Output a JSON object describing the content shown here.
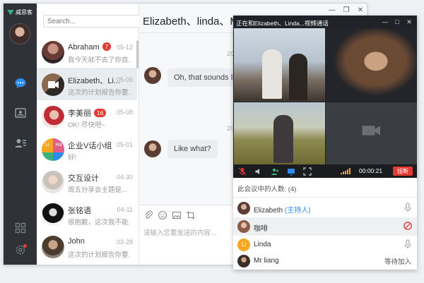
{
  "app": {
    "name": "威思客"
  },
  "sidebar": {
    "icons": [
      "chat-icon",
      "contacts-card-icon",
      "user-list-icon",
      "apps-grid-icon",
      "settings-icon"
    ]
  },
  "search": {
    "placeholder": "Search..."
  },
  "conversations": [
    {
      "name": "Abraham",
      "badge": "7",
      "time": "05-12",
      "preview": "我今天就不去了你自..."
    },
    {
      "name": "Elizabeth、Li...",
      "badge": "",
      "time": "05-09",
      "preview": "这次的计划报告你要..."
    },
    {
      "name": "李美丽",
      "badge": "16",
      "time": "05-08",
      "preview": "OK! 尽快吧~"
    },
    {
      "name": "企业V话小组",
      "badge": "",
      "time": "05-01",
      "preview": "好!"
    },
    {
      "name": "交互设计",
      "badge": "",
      "time": "04-30",
      "preview": "周五分享会主题是..."
    },
    {
      "name": "张铭语",
      "badge": "",
      "time": "04-11",
      "preview": "很抱歉，这次我不能..."
    },
    {
      "name": "John",
      "badge": "",
      "time": "03-28",
      "preview": "这次的计划报告你要..."
    }
  ],
  "group_avatar": {
    "cells": [
      "Li",
      "Ha",
      "",
      ""
    ]
  },
  "chat": {
    "title": "Elizabeth、linda、Mr li",
    "timestamps": [
      "20",
      "20"
    ],
    "messages": [
      "Oh, that sounds like",
      "Like what?"
    ],
    "compose_placeholder": "请输入您要发送的内容..."
  },
  "video": {
    "title": "正在和Elizabeth、Linda...视频通话",
    "timer": "00:00:21",
    "hangup_label": "挂断"
  },
  "participants": {
    "header": "此会议中的人数:  (4)",
    "rows": [
      {
        "name": "Elizabeth",
        "tag": "(主持人)",
        "status": "",
        "icon": "mic-icon"
      },
      {
        "name": "咖啡",
        "tag": "",
        "status": "",
        "icon": "muted-icon"
      },
      {
        "name": "Linda",
        "tag": "",
        "status": "",
        "icon": "mic-icon",
        "initials": "Li"
      },
      {
        "name": "Mr liang",
        "tag": "",
        "status": "等待加入",
        "icon": ""
      }
    ]
  },
  "colors": {
    "accent": "#2d8cf0",
    "danger": "#e53935",
    "sidebar": "#2f3338",
    "brand": "#3bb27b"
  }
}
